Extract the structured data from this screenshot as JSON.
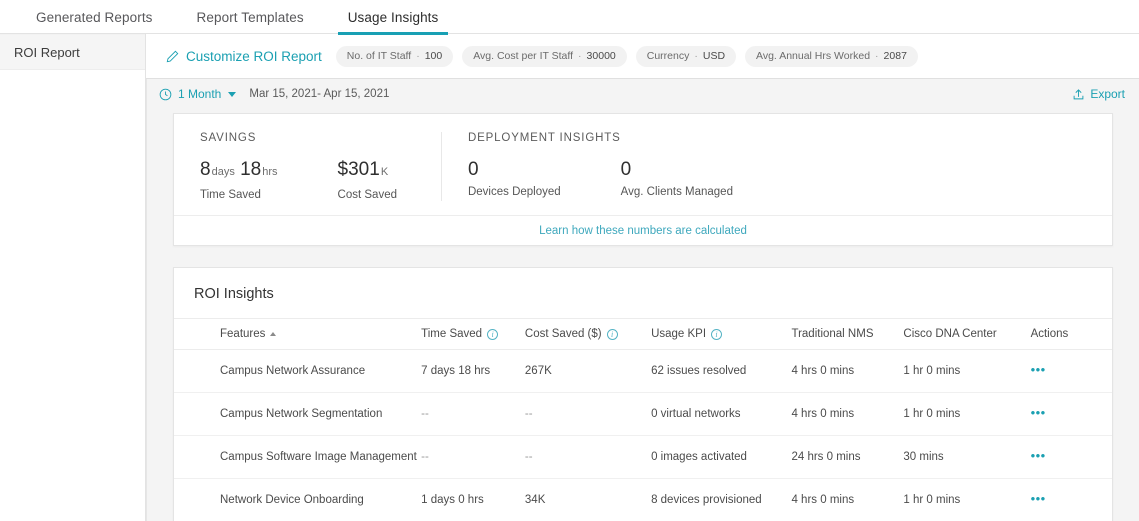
{
  "tabs": [
    {
      "label": "Generated Reports",
      "active": false
    },
    {
      "label": "Report Templates",
      "active": false
    },
    {
      "label": "Usage Insights",
      "active": true
    }
  ],
  "sidebar": {
    "items": [
      {
        "label": "ROI Report",
        "selected": true
      }
    ]
  },
  "customize_bar": {
    "link_label": "Customize ROI Report",
    "chips": [
      {
        "label": "No. of IT Staff",
        "value": "100"
      },
      {
        "label": "Avg. Cost per IT Staff",
        "value": "30000"
      },
      {
        "label": "Currency",
        "value": "USD"
      },
      {
        "label": "Avg. Annual Hrs Worked",
        "value": "2087"
      }
    ]
  },
  "range_bar": {
    "range_label": "1 Month",
    "dates": "Mar 15, 2021- Apr 15, 2021",
    "export_label": "Export"
  },
  "summary": {
    "savings_title": "SAVINGS",
    "deployment_title": "DEPLOYMENT INSIGHTS",
    "time_saved_days": "8",
    "time_saved_days_unit": "days",
    "time_saved_hrs": "18",
    "time_saved_hrs_unit": "hrs",
    "time_saved_label": "Time Saved",
    "cost_saved_value": "$301",
    "cost_saved_unit": "K",
    "cost_saved_label": "Cost Saved",
    "devices_deployed_value": "0",
    "devices_deployed_label": "Devices Deployed",
    "avg_clients_value": "0",
    "avg_clients_label": "Avg. Clients Managed",
    "learn_link": "Learn how these numbers are calculated"
  },
  "insights": {
    "title": "ROI Insights",
    "columns": [
      "Features",
      "Time Saved",
      "Cost Saved ($)",
      "Usage KPI",
      "Traditional NMS",
      "Cisco DNA Center",
      "Actions"
    ],
    "rows": [
      {
        "feature": "Campus Network Assurance",
        "time_saved": "7 days 18 hrs",
        "cost_saved": "267K",
        "usage_kpi": "62 issues resolved",
        "traditional_nms": "4 hrs 0 mins",
        "dna_center": "1 hr 0 mins",
        "actions": "•••"
      },
      {
        "feature": "Campus Network Segmentation",
        "time_saved": "--",
        "cost_saved": "--",
        "usage_kpi": "0 virtual networks",
        "traditional_nms": "4 hrs 0 mins",
        "dna_center": "1 hr 0 mins",
        "actions": "•••"
      },
      {
        "feature": "Campus Software Image Management",
        "time_saved": "--",
        "cost_saved": "--",
        "usage_kpi": "0 images activated",
        "traditional_nms": "24 hrs 0 mins",
        "dna_center": "30 mins",
        "actions": "•••"
      },
      {
        "feature": "Network Device Onboarding",
        "time_saved": "1 days 0 hrs",
        "cost_saved": "34K",
        "usage_kpi": "8 devices provisioned",
        "traditional_nms": "4 hrs 0 mins",
        "dna_center": "1 hr 0 mins",
        "actions": "•••"
      }
    ]
  },
  "colors": {
    "accent": "#1ba0b2",
    "tab_underline": "#18a0b4",
    "page_bg": "#f4f4f4",
    "card_bg": "#ffffff"
  }
}
